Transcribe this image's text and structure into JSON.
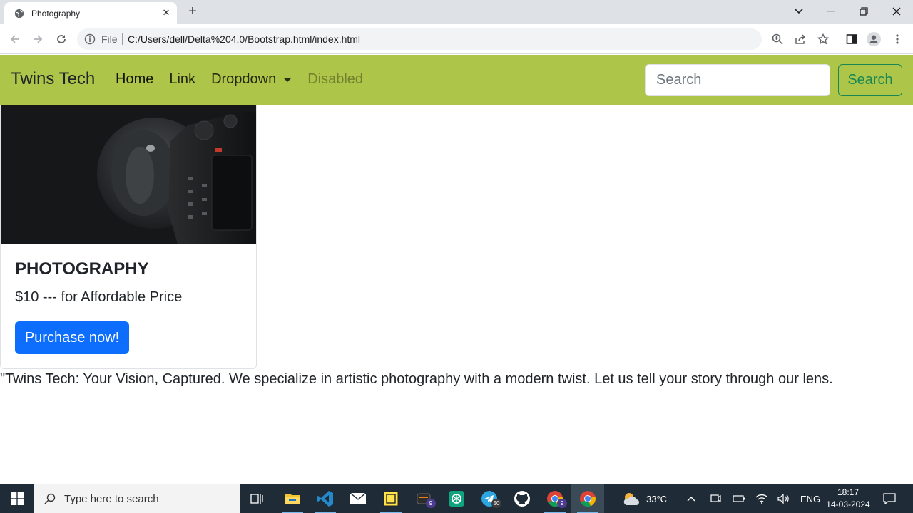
{
  "browser": {
    "tab_title": "Photography",
    "url_scheme_label": "File",
    "url": "C:/Users/dell/Delta%204.0/Bootstrap.html/index.html"
  },
  "navbar": {
    "brand": "Twins Tech",
    "links": [
      "Home",
      "Link",
      "Dropdown",
      "Disabled"
    ],
    "search_placeholder": "Search",
    "search_button": "Search",
    "background": "#adc548"
  },
  "card": {
    "title": "PHOTOGRAPHY",
    "text": "$10 --- for Affordable Price",
    "button": "Purchase now!"
  },
  "tagline": "\"Twins Tech: Your Vision, Captured. We specialize in artistic photography with a modern twist. Let us tell your story through our lens.",
  "taskbar": {
    "search_placeholder": "Type here to search",
    "weather": "33°C",
    "language": "ENG",
    "time": "18:17",
    "date": "14-03-2024",
    "badges": {
      "app1": "9",
      "telegram": "50",
      "chrome": "9"
    }
  }
}
